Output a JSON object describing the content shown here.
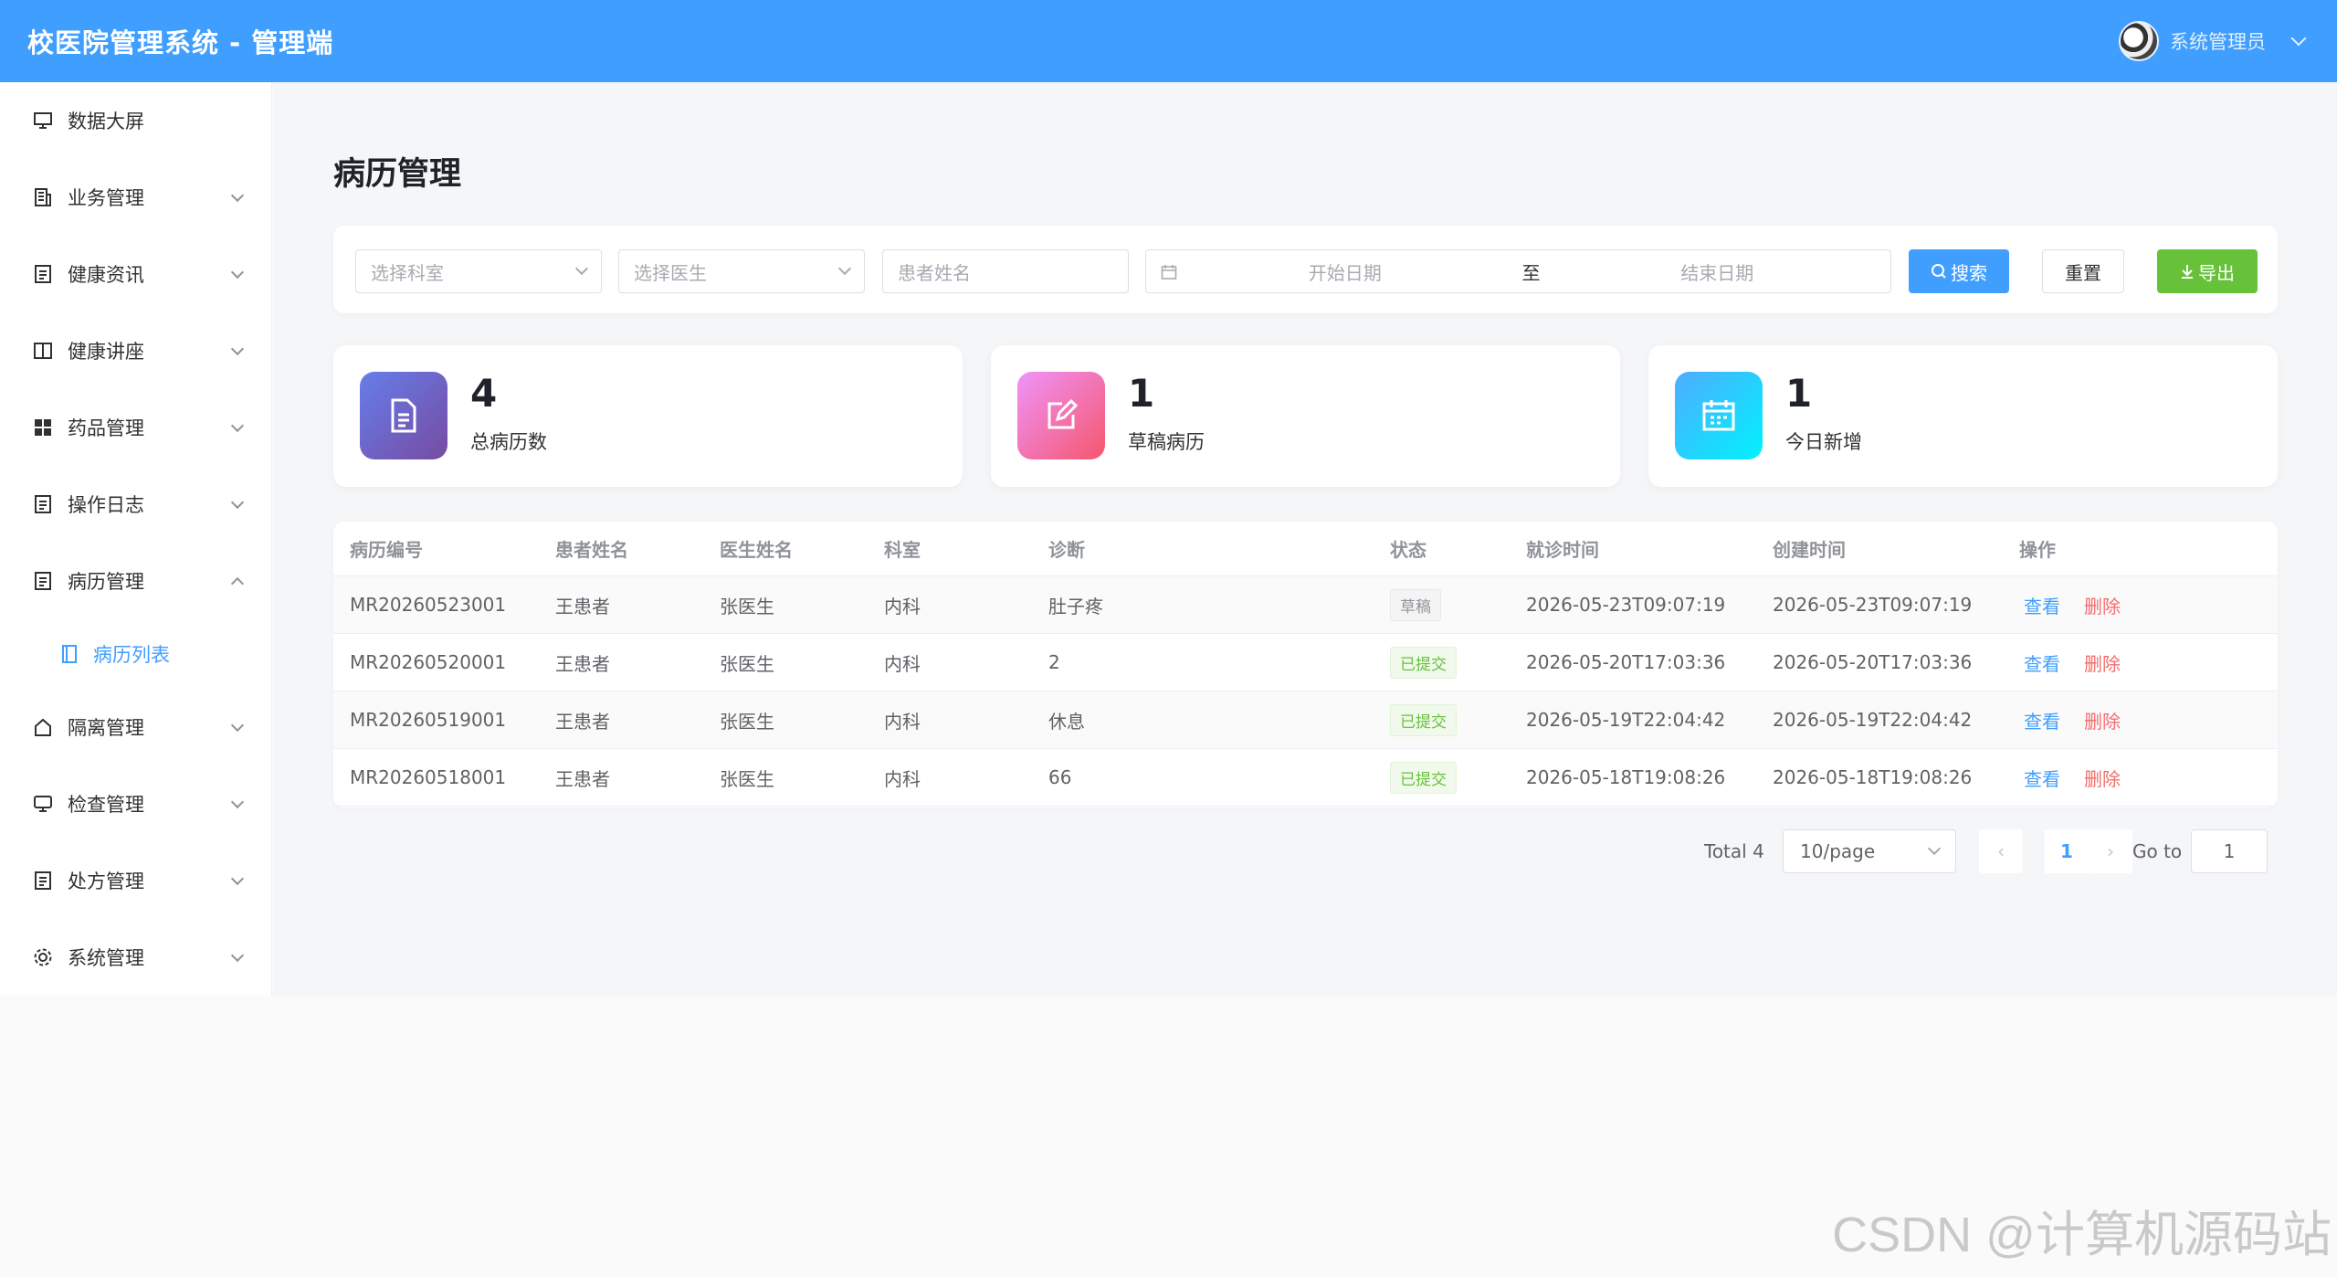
{
  "header": {
    "title": "校医院管理系统 - 管理端",
    "username": "系统管理员"
  },
  "sidebar": {
    "items": [
      {
        "label": "数据大屏",
        "icon": "monitor-icon"
      },
      {
        "label": "业务管理",
        "icon": "building-icon"
      },
      {
        "label": "健康资讯",
        "icon": "document-icon"
      },
      {
        "label": "健康讲座",
        "icon": "book-icon"
      },
      {
        "label": "药品管理",
        "icon": "grid-icon"
      },
      {
        "label": "操作日志",
        "icon": "document-icon"
      },
      {
        "label": "病历管理",
        "icon": "document-icon",
        "expanded": true
      },
      {
        "label": "隔离管理",
        "icon": "house-icon"
      },
      {
        "label": "检查管理",
        "icon": "monitor-icon"
      },
      {
        "label": "处方管理",
        "icon": "document-icon"
      },
      {
        "label": "系统管理",
        "icon": "gear-icon"
      }
    ],
    "submenu": {
      "label": "病历列表",
      "icon": "tablet-icon"
    }
  },
  "page": {
    "title": "病历管理"
  },
  "filters": {
    "department_placeholder": "选择科室",
    "doctor_placeholder": "选择医生",
    "patient_placeholder": "患者姓名",
    "start_date_placeholder": "开始日期",
    "range_separator": "至",
    "end_date_placeholder": "结束日期",
    "search_label": "搜索",
    "reset_label": "重置",
    "export_label": "导出"
  },
  "stats": [
    {
      "value": "4",
      "label": "总病历数"
    },
    {
      "value": "1",
      "label": "草稿病历"
    },
    {
      "value": "1",
      "label": "今日新增"
    }
  ],
  "table": {
    "columns": [
      "病历编号",
      "患者姓名",
      "医生姓名",
      "科室",
      "诊断",
      "状态",
      "就诊时间",
      "创建时间",
      "操作"
    ],
    "rows": [
      {
        "id": "MR20260523001",
        "patient": "王患者",
        "doctor": "张医生",
        "dept": "内科",
        "diagnosis": "肚子疼",
        "status": "草稿",
        "visit_time": "2026-05-23T09:07:19",
        "created_time": "2026-05-23T09:07:19"
      },
      {
        "id": "MR20260520001",
        "patient": "王患者",
        "doctor": "张医生",
        "dept": "内科",
        "diagnosis": "2",
        "status": "已提交",
        "visit_time": "2026-05-20T17:03:36",
        "created_time": "2026-05-20T17:03:36"
      },
      {
        "id": "MR20260519001",
        "patient": "王患者",
        "doctor": "张医生",
        "dept": "内科",
        "diagnosis": "休息",
        "status": "已提交",
        "visit_time": "2026-05-19T22:04:42",
        "created_time": "2026-05-19T22:04:42"
      },
      {
        "id": "MR20260518001",
        "patient": "王患者",
        "doctor": "张医生",
        "dept": "内科",
        "diagnosis": "66",
        "status": "已提交",
        "visit_time": "2026-05-18T19:08:26",
        "created_time": "2026-05-18T19:08:26"
      }
    ],
    "view_label": "查看",
    "delete_label": "删除"
  },
  "pagination": {
    "total": "Total 4",
    "page_size": "10/page",
    "current": "1",
    "goto_label": "Go to",
    "goto_value": "1"
  },
  "watermark": "CSDN @计算机源码站",
  "colors": {
    "primary": "#409eff",
    "success": "#67c23a",
    "danger": "#f56c6c"
  }
}
